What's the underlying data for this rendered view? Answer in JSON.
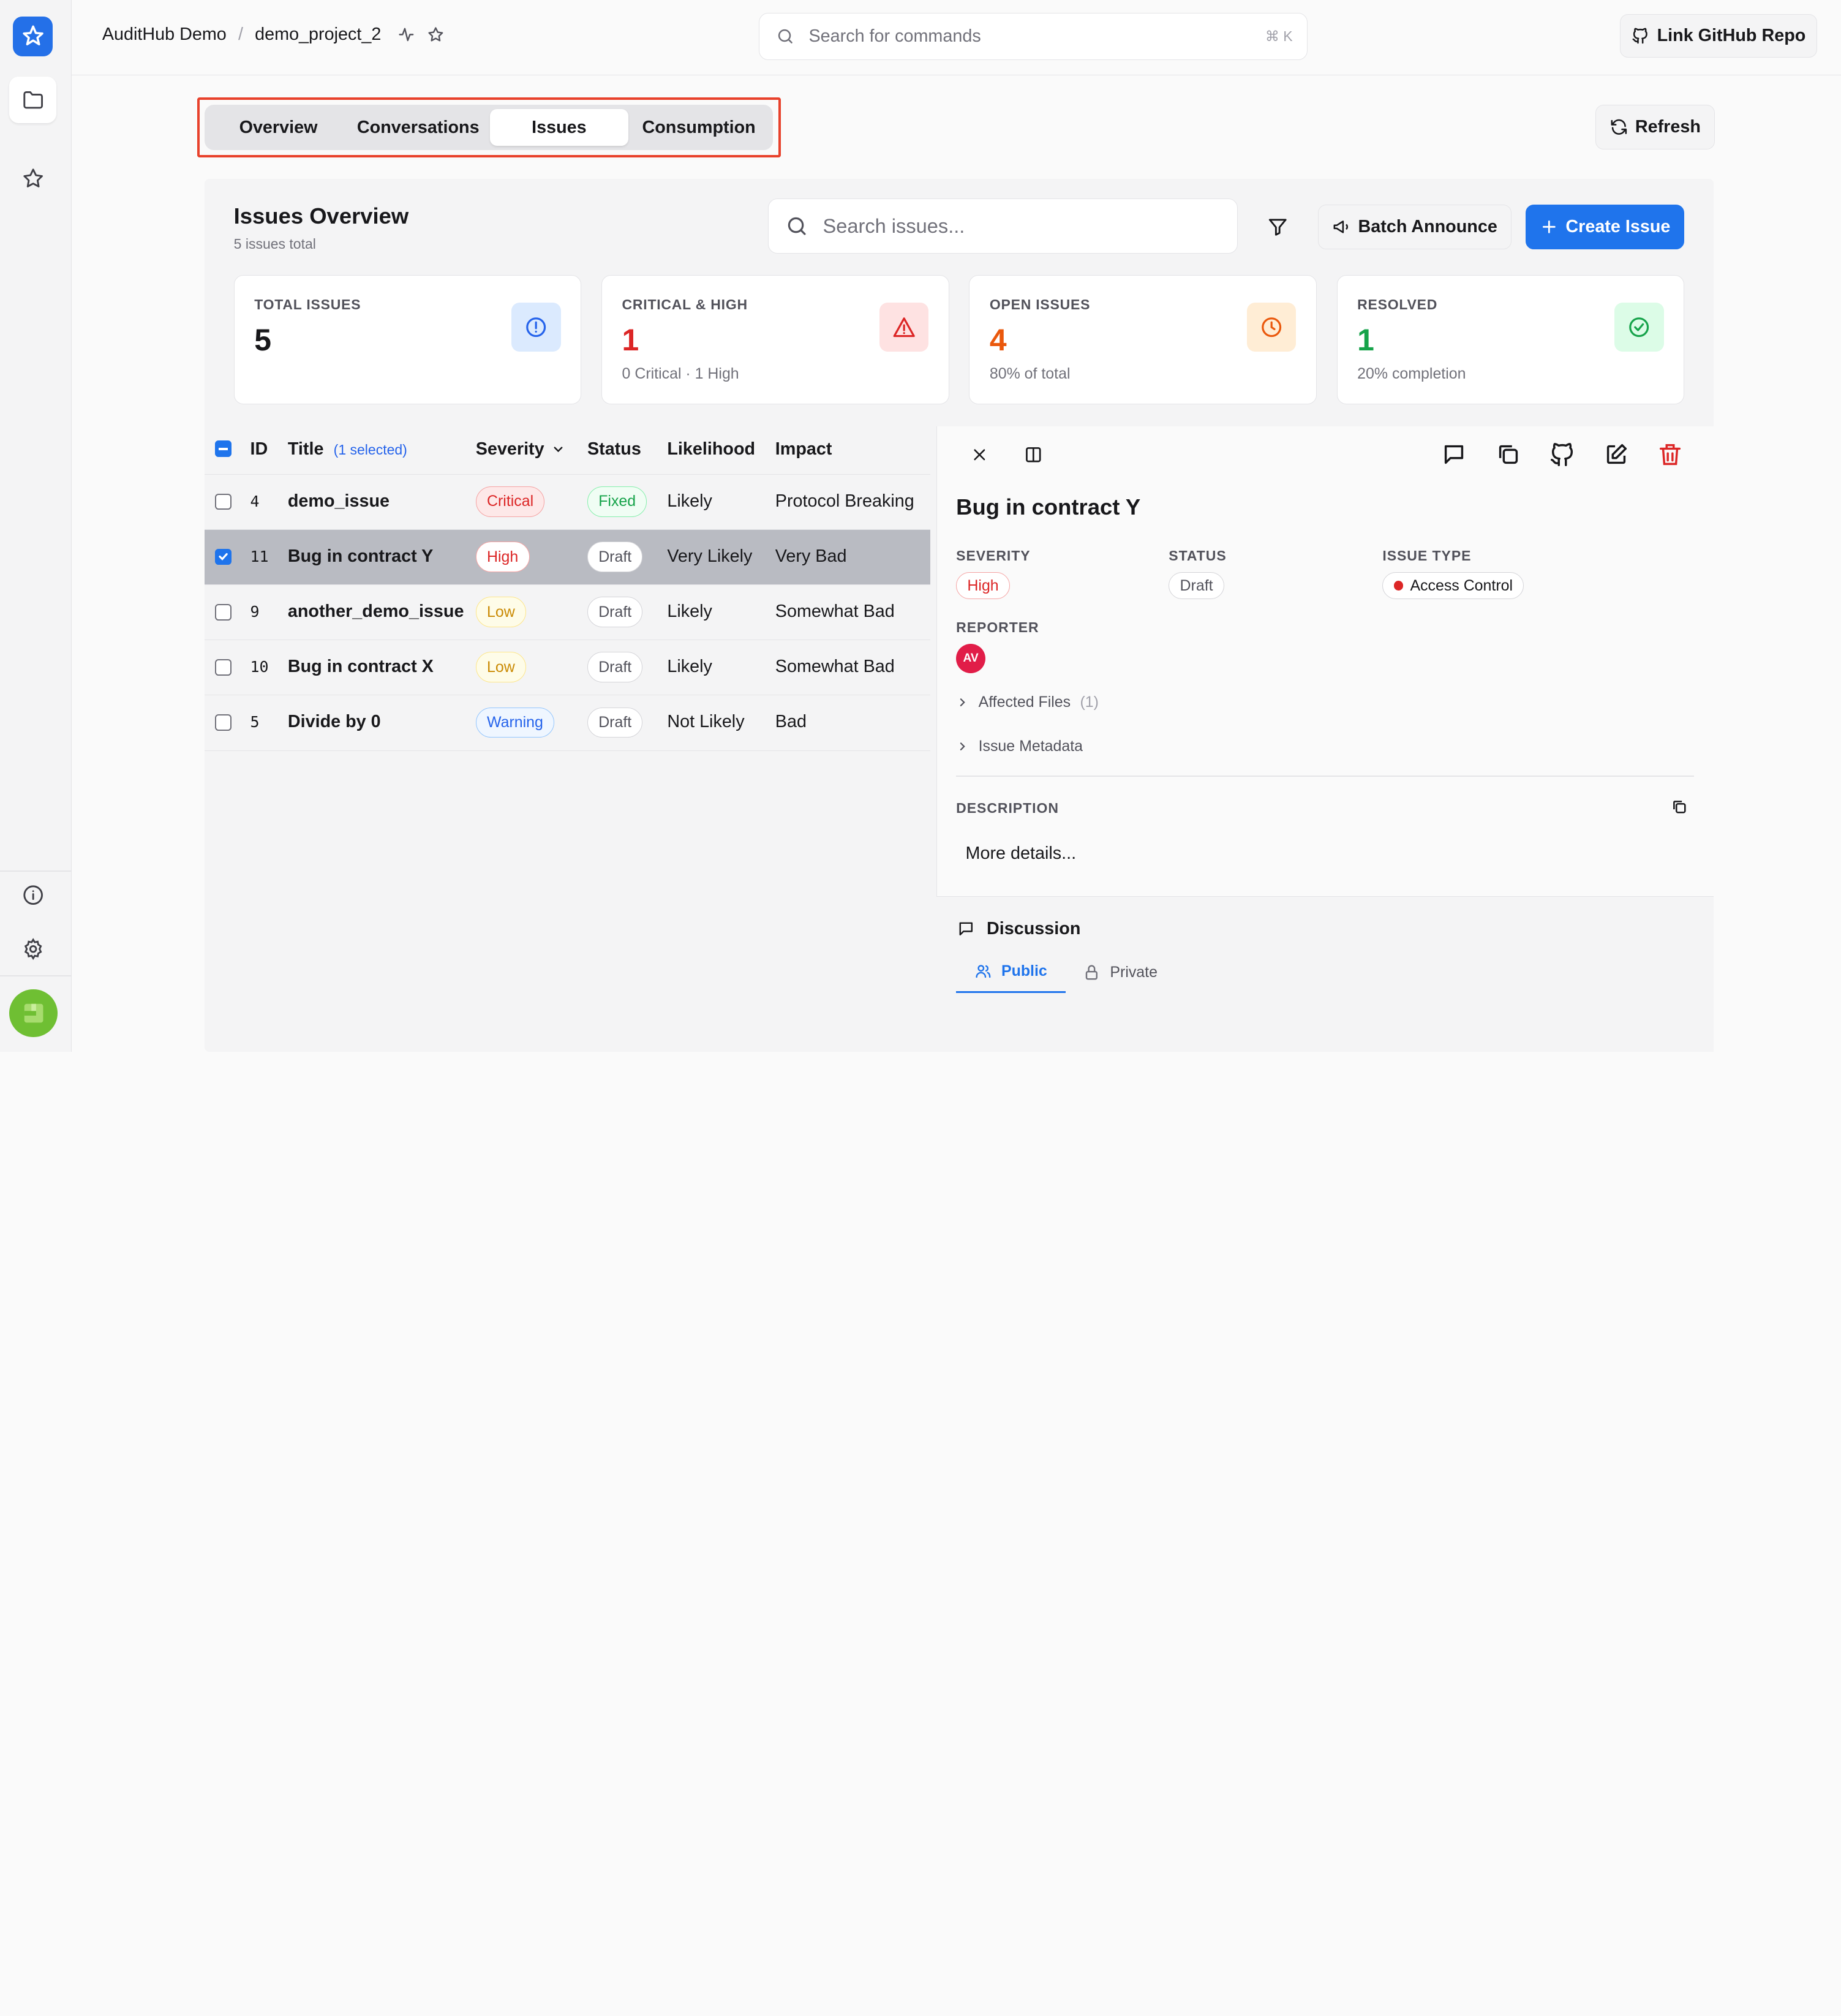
{
  "header": {
    "workspace": "AuditHub Demo",
    "separator": "/",
    "project": "demo_project_2",
    "command_search_placeholder": "Search for commands",
    "command_shortcut": "⌘ K",
    "link_github_label": "Link GitHub Repo"
  },
  "tabs": [
    {
      "label": "Overview",
      "active": false
    },
    {
      "label": "Conversations",
      "active": false
    },
    {
      "label": "Issues",
      "active": true
    },
    {
      "label": "Consumption",
      "active": false
    }
  ],
  "refresh_label": "Refresh",
  "issues": {
    "title": "Issues Overview",
    "subtitle": "5 issues total",
    "search_placeholder": "Search issues...",
    "batch_announce_label": "Batch Announce",
    "create_issue_label": "Create Issue"
  },
  "stats": [
    {
      "label": "TOTAL ISSUES",
      "value": "5",
      "sub": "",
      "color": "#18181b",
      "icon": "alert-circle-icon",
      "icon_bg": "#dbeafe",
      "icon_color": "#2563eb"
    },
    {
      "label": "CRITICAL & HIGH",
      "value": "1",
      "sub": "0 Critical · 1 High",
      "color": "#dc2626",
      "icon": "alert-triangle-icon",
      "icon_bg": "#fee2e2",
      "icon_color": "#dc2626"
    },
    {
      "label": "OPEN ISSUES",
      "value": "4",
      "sub": "80% of total",
      "color": "#ea580c",
      "icon": "clock-icon",
      "icon_bg": "#ffedd5",
      "icon_color": "#ea580c"
    },
    {
      "label": "RESOLVED",
      "value": "1",
      "sub": "20% completion",
      "color": "#16a34a",
      "icon": "check-circle-icon",
      "icon_bg": "#dcfce7",
      "icon_color": "#16a34a"
    }
  ],
  "table": {
    "headers": {
      "id": "ID",
      "title": "Title",
      "selected": "(1 selected)",
      "severity": "Severity",
      "status": "Status",
      "likelihood": "Likelihood",
      "impact": "Impact"
    },
    "rows": [
      {
        "id": "4",
        "title": "demo_issue",
        "severity": "Critical",
        "status": "Fixed",
        "likelihood": "Likely",
        "impact": "Protocol Breaking",
        "checked": false
      },
      {
        "id": "11",
        "title": "Bug in contract Y",
        "severity": "High",
        "status": "Draft",
        "likelihood": "Very Likely",
        "impact": "Very Bad",
        "checked": true
      },
      {
        "id": "9",
        "title": "another_demo_issue",
        "severity": "Low",
        "status": "Draft",
        "likelihood": "Likely",
        "impact": "Somewhat Bad",
        "checked": false
      },
      {
        "id": "10",
        "title": "Bug in contract X",
        "severity": "Low",
        "status": "Draft",
        "likelihood": "Likely",
        "impact": "Somewhat Bad",
        "checked": false
      },
      {
        "id": "5",
        "title": "Divide by 0",
        "severity": "Warning",
        "status": "Draft",
        "likelihood": "Not Likely",
        "impact": "Bad",
        "checked": false
      }
    ]
  },
  "detail": {
    "title": "Bug in contract Y",
    "severity_label": "SEVERITY",
    "severity": "High",
    "status_label": "STATUS",
    "status": "Draft",
    "type_label": "ISSUE TYPE",
    "type": "Access Control",
    "reporter_label": "REPORTER",
    "reporter_initials": "AV",
    "affected_files_label": "Affected Files",
    "affected_files_count": "(1)",
    "metadata_label": "Issue Metadata",
    "description_label": "DESCRIPTION",
    "description": "More details...",
    "discussion_label": "Discussion",
    "public_label": "Public",
    "private_label": "Private"
  }
}
